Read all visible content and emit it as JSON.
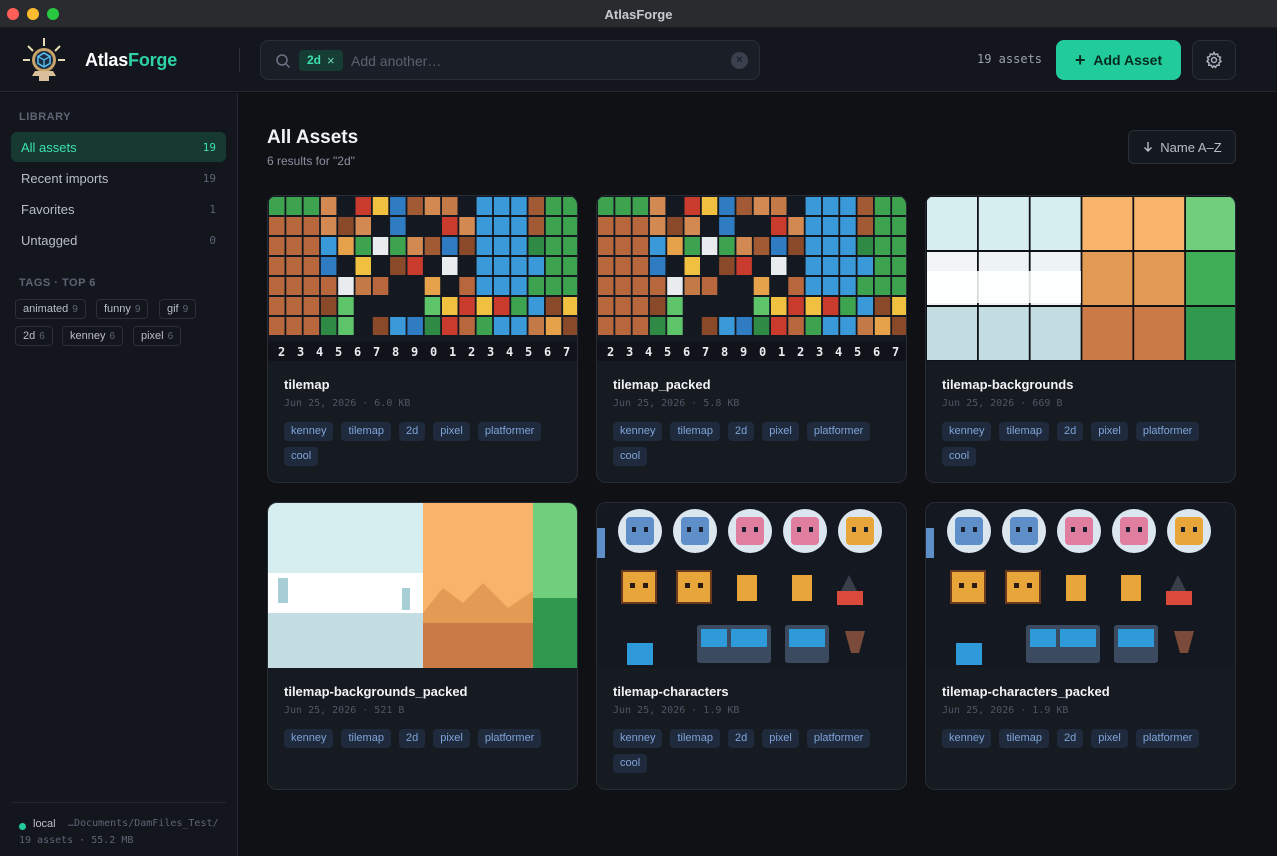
{
  "window": {
    "title": "AtlasForge"
  },
  "brand": {
    "name_a": "Atlas",
    "name_b": "Forge"
  },
  "search": {
    "chip": "2d",
    "chip_remove": "×",
    "placeholder": "Add another…",
    "clear": "×"
  },
  "header": {
    "asset_count": "19 assets",
    "add_label": "Add Asset",
    "add_plus": "+"
  },
  "sidebar": {
    "library_label": "LIBRARY",
    "items": [
      {
        "label": "All assets",
        "count": "19"
      },
      {
        "label": "Recent imports",
        "count": "19"
      },
      {
        "label": "Favorites",
        "count": "1"
      },
      {
        "label": "Untagged",
        "count": "0"
      }
    ],
    "tags_label": "TAGS · TOP 6",
    "tags": [
      {
        "name": "animated",
        "count": "9"
      },
      {
        "name": "funny",
        "count": "9"
      },
      {
        "name": "gif",
        "count": "9"
      },
      {
        "name": "2d",
        "count": "6"
      },
      {
        "name": "kenney",
        "count": "6"
      },
      {
        "name": "pixel",
        "count": "6"
      }
    ],
    "footer": {
      "location": "local",
      "path": "…Documents/DamFiles_Test/",
      "meta": "19 assets · 55.2 MB"
    }
  },
  "main": {
    "title": "All Assets",
    "subtitle": "6 results for \"2d\"",
    "sort_label": "Name A–Z",
    "cards": [
      {
        "title": "tilemap",
        "meta": "Jun 25, 2026 · 6.0 KB",
        "thumb": "tiles",
        "tags": [
          "kenney",
          "tilemap",
          "2d",
          "pixel",
          "platformer",
          "cool"
        ]
      },
      {
        "title": "tilemap_packed",
        "meta": "Jun 25, 2026 · 5.8 KB",
        "thumb": "tiles",
        "tags": [
          "kenney",
          "tilemap",
          "2d",
          "pixel",
          "platformer",
          "cool"
        ]
      },
      {
        "title": "tilemap-backgrounds",
        "meta": "Jun 25, 2026 · 669 B",
        "thumb": "bg-grid",
        "tags": [
          "kenney",
          "tilemap",
          "2d",
          "pixel",
          "platformer",
          "cool"
        ]
      },
      {
        "title": "tilemap-backgrounds_packed",
        "meta": "Jun 25, 2026 · 521 B",
        "thumb": "bg",
        "tags": [
          "kenney",
          "tilemap",
          "2d",
          "pixel",
          "platformer"
        ]
      },
      {
        "title": "tilemap-characters",
        "meta": "Jun 25, 2026 · 1.9 KB",
        "thumb": "chars",
        "tags": [
          "kenney",
          "tilemap",
          "2d",
          "pixel",
          "platformer",
          "cool"
        ]
      },
      {
        "title": "tilemap-characters_packed",
        "meta": "Jun 25, 2026 · 1.9 KB",
        "thumb": "chars",
        "tags": [
          "kenney",
          "tilemap",
          "2d",
          "pixel",
          "platformer"
        ]
      }
    ]
  },
  "colors": {
    "accent": "#22cc9a",
    "accent_text": "#3fe0b0",
    "tag_bg": "#1f2a3c",
    "tag_text": "#7fa4d9"
  }
}
